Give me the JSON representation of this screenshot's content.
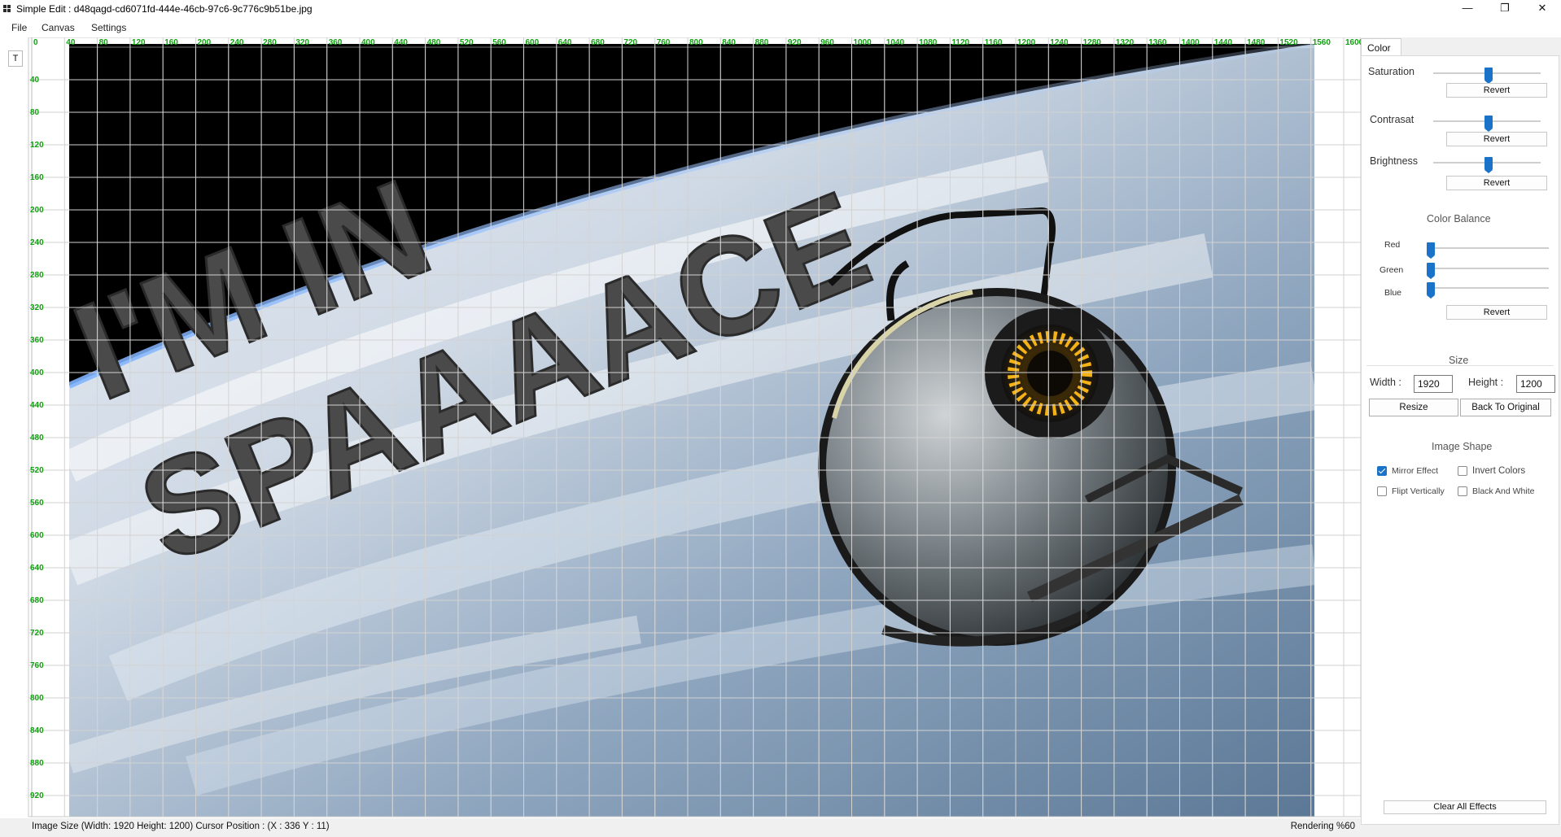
{
  "window": {
    "title": "Simple Edit : d48qagd-cd6071fd-444e-46cb-97c6-9c776c9b51be.jpg",
    "minimize_glyph": "—",
    "maximize_glyph": "❐",
    "close_glyph": "✕"
  },
  "menu": {
    "file": "File",
    "canvas": "Canvas",
    "settings": "Settings"
  },
  "toolbar": {
    "text_tool": "T"
  },
  "rulers": {
    "top": [
      "0",
      "40",
      "80",
      "120",
      "160",
      "200",
      "240",
      "280",
      "320",
      "360",
      "400",
      "440",
      "480",
      "520",
      "560",
      "600",
      "640",
      "680",
      "720",
      "760",
      "800",
      "840",
      "880",
      "920",
      "960",
      "1000",
      "1040",
      "1080",
      "1120",
      "1160",
      "1200",
      "1240",
      "1280",
      "1320",
      "1360",
      "1400",
      "1440",
      "1480",
      "1520",
      "1560",
      "1600"
    ],
    "left": [
      "40",
      "80",
      "120",
      "160",
      "200",
      "240",
      "280",
      "320",
      "360",
      "400",
      "440",
      "480",
      "520",
      "560",
      "600",
      "640",
      "680",
      "720",
      "760",
      "800",
      "840",
      "880",
      "920"
    ],
    "label_color": "#12a012"
  },
  "image": {
    "overlay_line1": "I'M IN",
    "overlay_line2": "SPAAAACE"
  },
  "status": {
    "info": "Image Size (Width: 1920 Height: 1200) Cursor Position : (X : 336 Y : 11)",
    "rendering": "Rendering %60"
  },
  "panel": {
    "tab": "Color",
    "saturation": {
      "label": "Saturation",
      "value": 0.52,
      "revert": "Revert"
    },
    "contrast": {
      "label": "Contrasat",
      "value": 0.52,
      "revert": "Revert"
    },
    "brightness": {
      "label": "Brightness",
      "value": 0.52,
      "revert": "Revert"
    },
    "color_balance": {
      "title": "Color Balance",
      "red": {
        "label": "Red",
        "value": 0.0
      },
      "green": {
        "label": "Green",
        "value": 0.0
      },
      "blue": {
        "label": "Blue",
        "value": 0.0
      },
      "revert": "Revert"
    },
    "size": {
      "title": "Size",
      "width_label": "Width :",
      "width_value": "1920",
      "height_label": "Height :",
      "height_value": "1200",
      "resize": "Resize",
      "back": "Back To Original"
    },
    "image_shape": {
      "title": "Image Shape",
      "mirror": {
        "label": "Mirror Effect",
        "checked": true
      },
      "invert": {
        "label": "Invert Colors",
        "checked": false
      },
      "flip": {
        "label": "Flipt Vertically",
        "checked": false
      },
      "bw": {
        "label": "Black And White",
        "checked": false
      }
    },
    "clear_all": "Clear All Effects"
  }
}
